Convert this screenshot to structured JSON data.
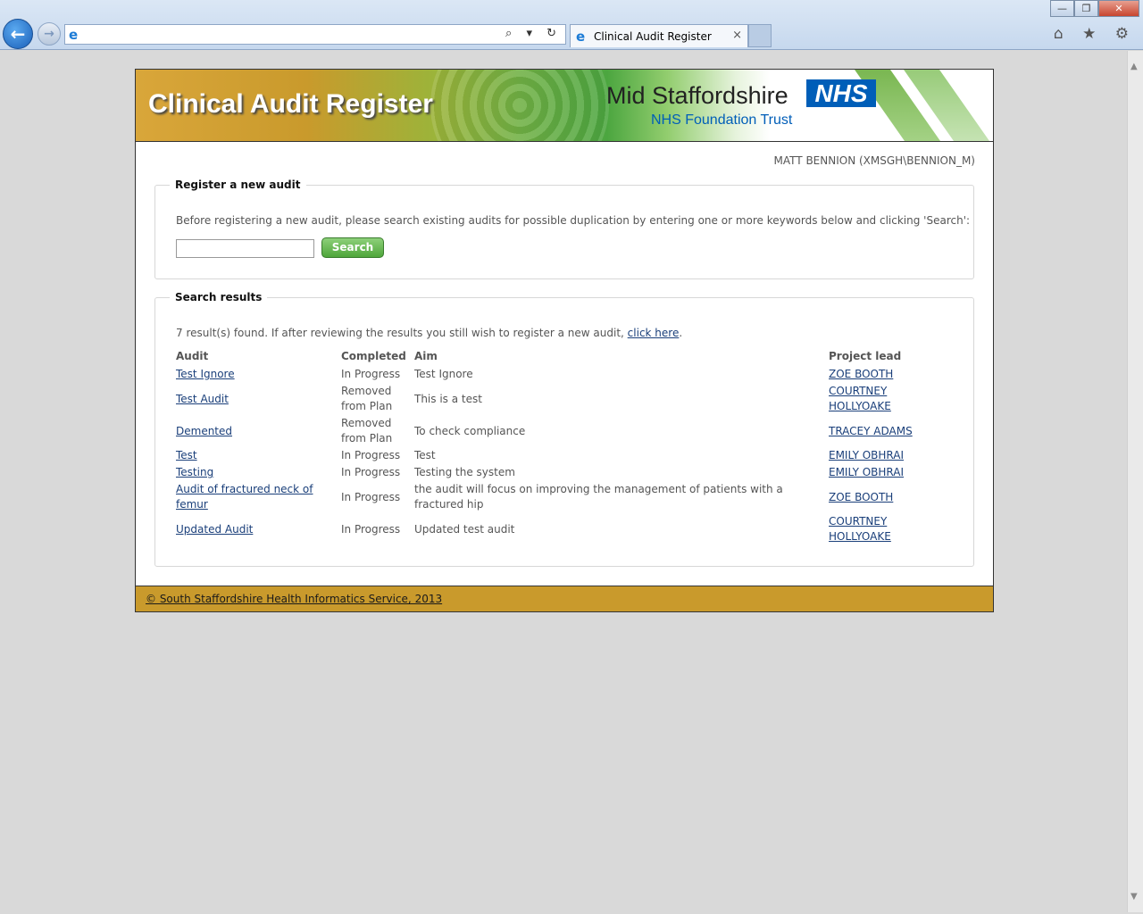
{
  "browser": {
    "tab_title": "Clinical Audit Register",
    "back_glyph": "←",
    "forward_glyph": "→",
    "address_tools": "⌕ ▾ ↻",
    "tab_close": "×",
    "window_buttons": {
      "minimize": "—",
      "maximize": "❐",
      "close": "✕"
    },
    "fav_icons": "⌂ ★ ⚙"
  },
  "banner": {
    "title": "Clinical Audit Register",
    "org_name": "Mid Staffordshire",
    "nhs_logo": "NHS",
    "org_sub": "NHS Foundation Trust"
  },
  "user": "MATT BENNION (XMSGH\\BENNION_M)",
  "register": {
    "legend": "Register a new audit",
    "intro": "Before registering a new audit, please search existing audits for possible duplication by entering one or more keywords below and clicking 'Search':",
    "search_value": "",
    "search_button": "Search"
  },
  "results": {
    "legend": "Search results",
    "summary": "7 result(s) found. If after reviewing the results you still wish to register a new audit,",
    "click_here": "click here",
    "summary_end": ".",
    "headers": {
      "audit": "Audit",
      "completed": "Completed",
      "aim": "Aim",
      "lead": "Project lead"
    },
    "rows": [
      {
        "audit": "Test Ignore",
        "completed": "In Progress",
        "aim": "Test Ignore",
        "lead": "ZOE BOOTH"
      },
      {
        "audit": "Test Audit",
        "completed": "Removed from Plan",
        "aim": "This is a test",
        "lead": "COURTNEY HOLLYOAKE"
      },
      {
        "audit": "Demented",
        "completed": "Removed from Plan",
        "aim": "To check compliance",
        "lead": "TRACEY ADAMS"
      },
      {
        "audit": "Test",
        "completed": "In Progress",
        "aim": "Test",
        "lead": "EMILY OBHRAI"
      },
      {
        "audit": "Testing",
        "completed": "In Progress",
        "aim": "Testing the system",
        "lead": "EMILY OBHRAI"
      },
      {
        "audit": "Audit of fractured neck of femur",
        "completed": "In Progress",
        "aim": "the audit will focus on improving the management of patients with a fractured hip",
        "lead": "ZOE BOOTH"
      },
      {
        "audit": "Updated Audit",
        "completed": "In Progress",
        "aim": "Updated test audit",
        "lead": "COURTNEY HOLLYOAKE"
      }
    ]
  },
  "footer": {
    "copyright": "© South Staffordshire Health Informatics Service, 2013"
  }
}
